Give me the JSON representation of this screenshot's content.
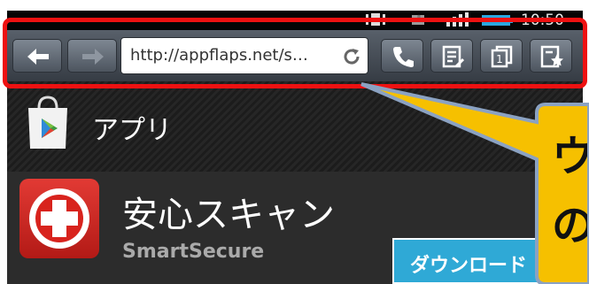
{
  "status_bar": {
    "time": "10:50",
    "battery_color": "#2aa7e0"
  },
  "browser": {
    "url": "http://appflaps.net/s…",
    "back_icon": "arrow-left-icon",
    "forward_icon": "arrow-right-icon",
    "reload_icon": "reload-icon",
    "toolbar_icons": [
      "phone-icon",
      "memo-icon",
      "tabs-icon",
      "bookmark-star-icon"
    ]
  },
  "store": {
    "section_label": "アプリ",
    "app_name": "安心スキャン",
    "app_developer": "SmartSecure",
    "download_label": "ダウンロード",
    "download_color": "#2fa9d6"
  },
  "annotation": {
    "highlight_color": "#ee1111",
    "callout_color": "#f6c000",
    "callout_text": "ウ\nの"
  }
}
